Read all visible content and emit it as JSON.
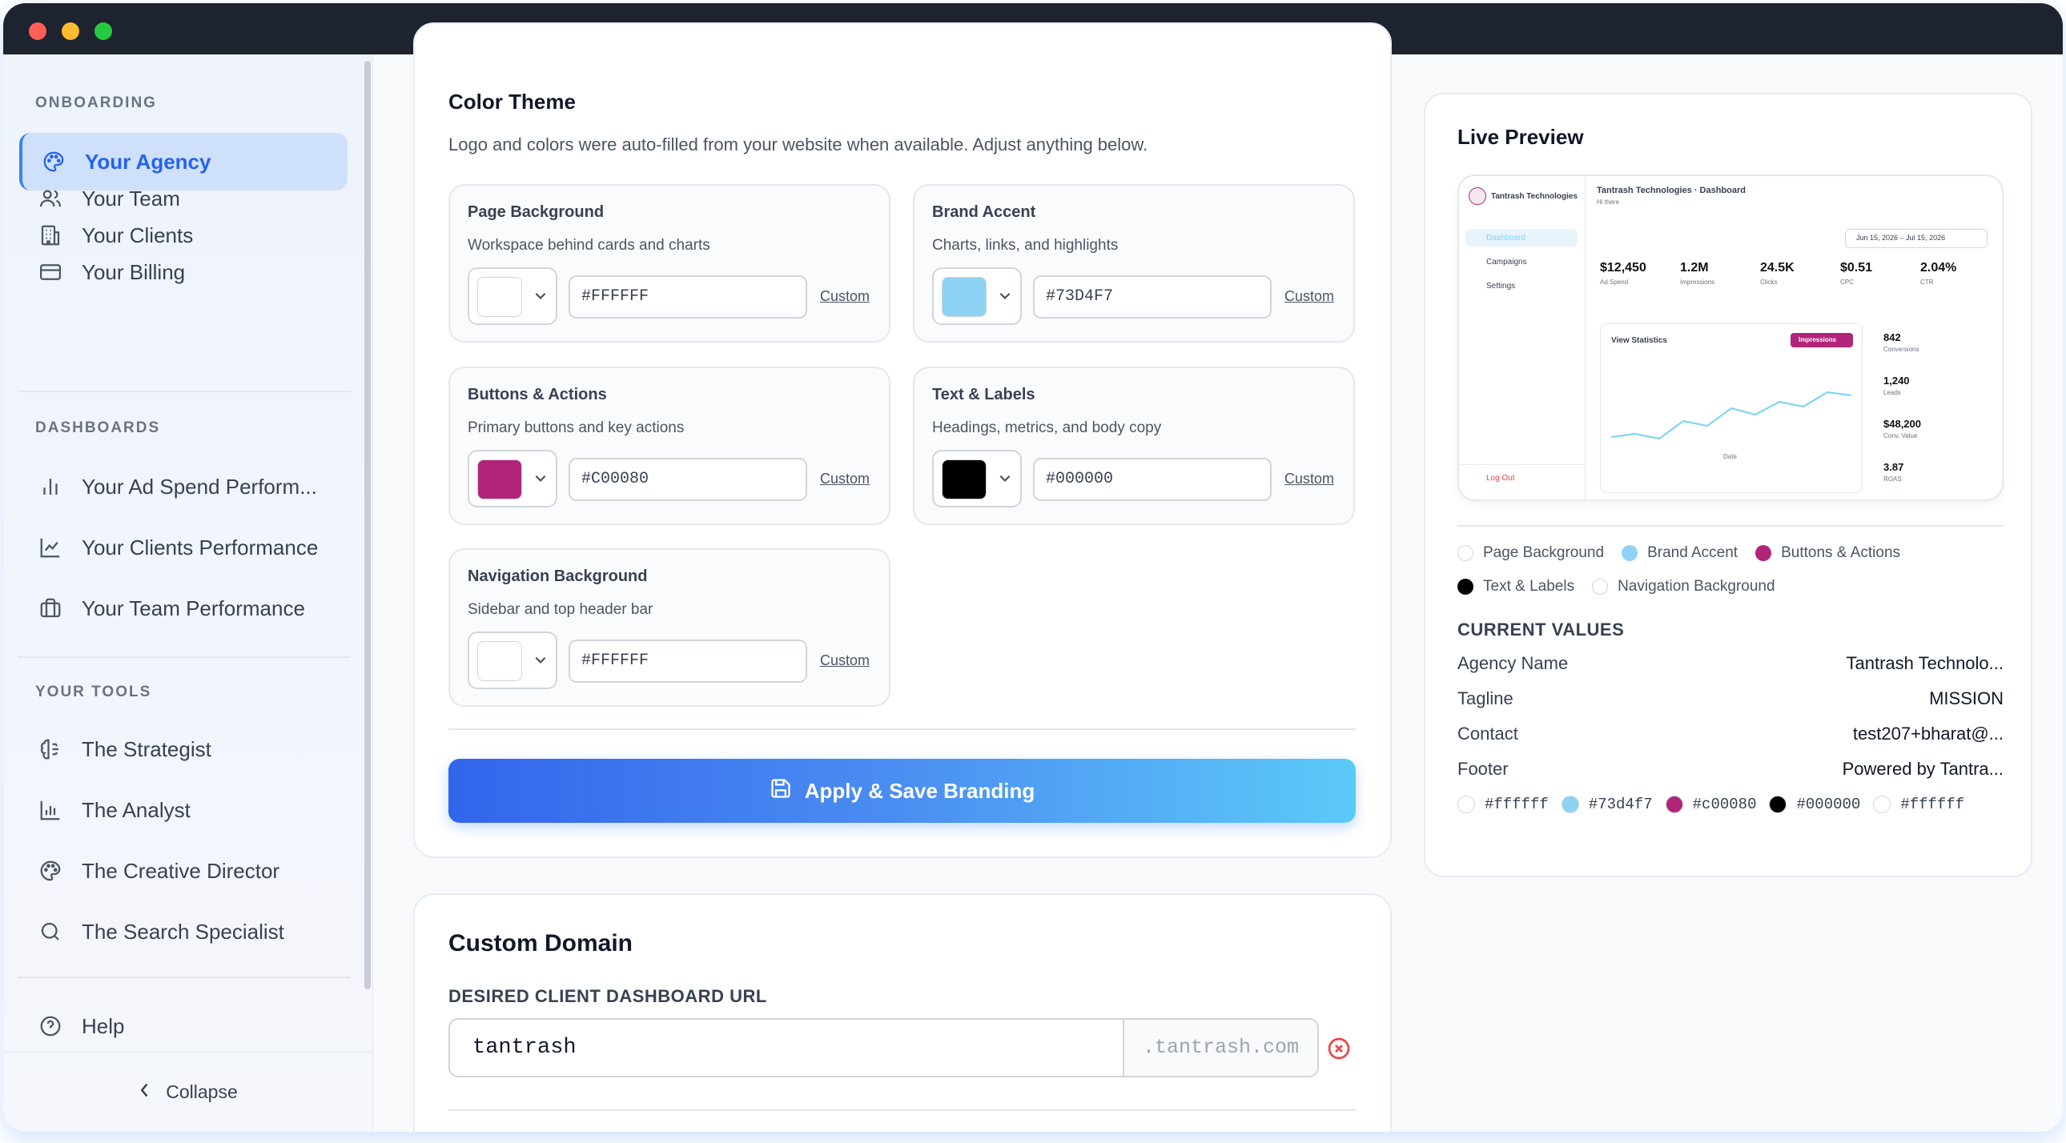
{
  "sidebar": {
    "sections": {
      "onboarding": "ONBOARDING",
      "dashboards": "DASHBOARDS",
      "tools": "YOUR TOOLS"
    },
    "onboarding_items": [
      {
        "label": "Your Agency",
        "icon": "palette-icon"
      },
      {
        "label": "Your Team",
        "icon": "users-icon"
      },
      {
        "label": "Your Clients",
        "icon": "building-icon"
      },
      {
        "label": "Your Billing",
        "icon": "credit-card-icon"
      }
    ],
    "dashboard_items": [
      {
        "label": "Your Ad Spend Perform...",
        "icon": "bar-chart-icon"
      },
      {
        "label": "Your Clients Performance",
        "icon": "line-chart-icon"
      },
      {
        "label": "Your Team Performance",
        "icon": "briefcase-icon"
      }
    ],
    "tool_items": [
      {
        "label": "The Strategist",
        "icon": "brain-icon"
      },
      {
        "label": "The Analyst",
        "icon": "bar-chart-icon"
      },
      {
        "label": "The Creative Director",
        "icon": "palette-icon"
      },
      {
        "label": "The Search Specialist",
        "icon": "search-icon"
      }
    ],
    "help": "Help",
    "collapse": "Collapse"
  },
  "color_theme": {
    "title": "Color Theme",
    "subtitle": "Logo and colors were auto-filled from your website when available. Adjust anything below.",
    "custom_label": "Custom",
    "swatches": [
      {
        "title": "Page Background",
        "desc": "Workspace behind cards and charts",
        "hex": "#FFFFFF",
        "color": "#ffffff"
      },
      {
        "title": "Brand Accent",
        "desc": "Charts, links, and highlights",
        "hex": "#73D4F7",
        "color": "#8fd3f4"
      },
      {
        "title": "Buttons & Actions",
        "desc": "Primary buttons and key actions",
        "hex": "#C00080",
        "color": "#b0257a"
      },
      {
        "title": "Text & Labels",
        "desc": "Headings, metrics, and body copy",
        "hex": "#000000",
        "color": "#000000"
      },
      {
        "title": "Navigation Background",
        "desc": "Sidebar and top header bar",
        "hex": "#FFFFFF",
        "color": "#ffffff"
      }
    ],
    "apply_button": "Apply & Save Branding"
  },
  "custom_domain": {
    "title": "Custom Domain",
    "field_label": "DESIRED CLIENT DASHBOARD URL",
    "value": "tantrash",
    "suffix": ".tantrash.com"
  },
  "live_preview": {
    "title": "Live Preview",
    "mini": {
      "brand": "Tantrash Technologies",
      "header_title": "Tantrash Technologies · Dashboard",
      "header_sub": "Hi there",
      "nav": [
        "Dashboard",
        "Campaigns",
        "Settings"
      ],
      "logout": "Log Out",
      "date_range": "Jun 15, 2026 – Jul 15, 2026",
      "metrics": [
        {
          "value": "$12,450",
          "label": "Ad Spend"
        },
        {
          "value": "1.2M",
          "label": "Impressions"
        },
        {
          "value": "24.5K",
          "label": "Clicks"
        },
        {
          "value": "$0.51",
          "label": "CPC"
        },
        {
          "value": "2.04%",
          "label": "CTR"
        }
      ],
      "chart_title": "View Statistics",
      "chart_badge": "Impressions",
      "chart_xlabel": "Date",
      "side_stats": [
        {
          "value": "842",
          "label": "Conversions"
        },
        {
          "value": "1,240",
          "label": "Leads"
        },
        {
          "value": "$48,200",
          "label": "Conv. Value"
        },
        {
          "value": "3.87",
          "label": "ROAS"
        }
      ]
    },
    "legend": [
      "Page Background",
      "Brand Accent",
      "Buttons & Actions",
      "Text & Labels",
      "Navigation Background"
    ],
    "current_values_title": "CURRENT VALUES",
    "current_values": [
      {
        "key": "Agency Name",
        "value": "Tantrash Technolo..."
      },
      {
        "key": "Tagline",
        "value": "MISSION"
      },
      {
        "key": "Contact",
        "value": "test207+bharat@..."
      },
      {
        "key": "Footer",
        "value": "Powered by Tantra..."
      }
    ],
    "color_values": [
      {
        "hex": "#ffffff",
        "color": "#ffffff"
      },
      {
        "hex": "#73d4f7",
        "color": "#8fd3f4"
      },
      {
        "hex": "#c00080",
        "color": "#b0257a"
      },
      {
        "hex": "#000000",
        "color": "#000000"
      },
      {
        "hex": "#ffffff",
        "color": "#ffffff"
      }
    ]
  }
}
